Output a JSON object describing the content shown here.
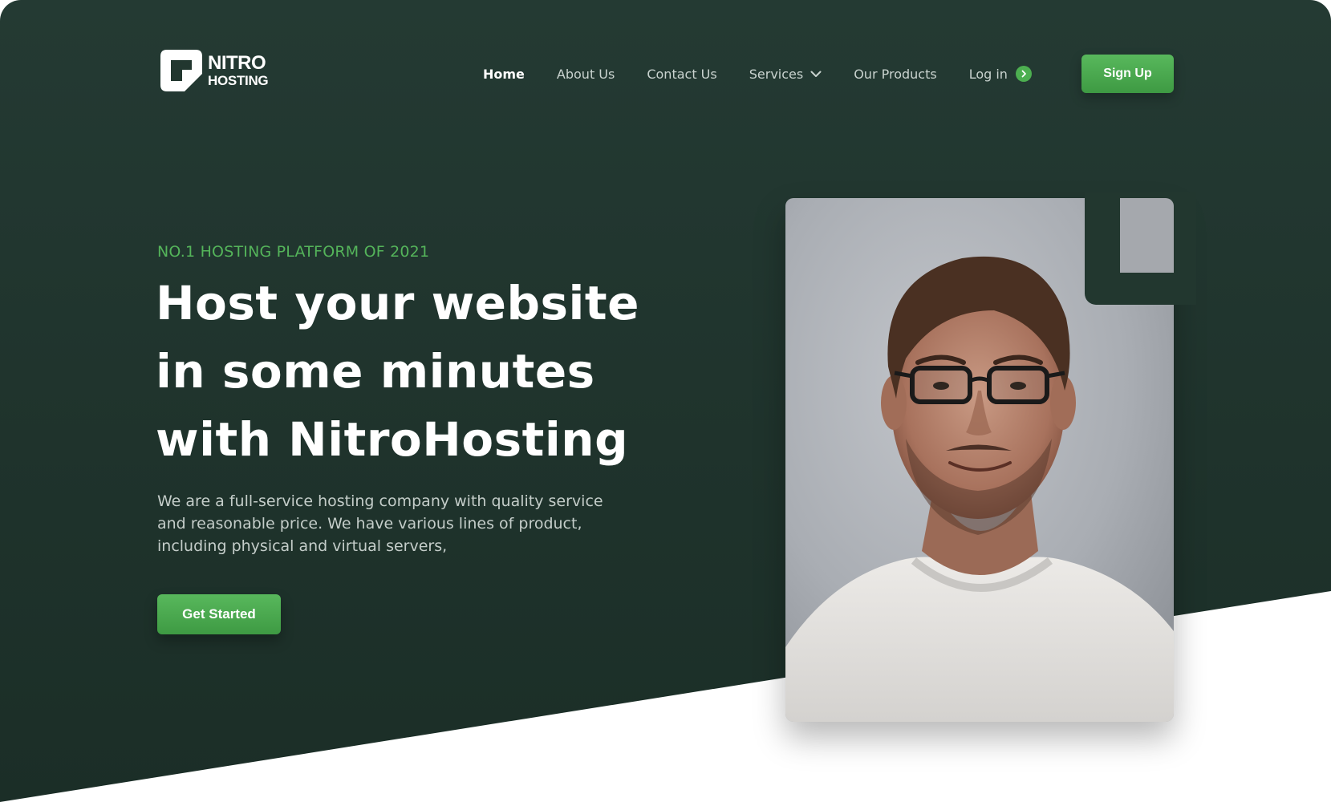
{
  "header": {
    "logo": {
      "line1": "NITRO",
      "line2": "HOSTING",
      "icon": "nitro-logo-icon"
    },
    "nav": [
      {
        "label": "Home",
        "active": true
      },
      {
        "label": "About Us"
      },
      {
        "label": "Contact Us"
      },
      {
        "label": "Services",
        "icon": "chevron-down-icon"
      },
      {
        "label": "Our Products"
      },
      {
        "label": "Log in",
        "icon": "arrow-right-circle-icon"
      }
    ],
    "signup_label": "Sign Up"
  },
  "hero": {
    "eyebrow": "NO.1 HOSTING PLATFORM OF 2021",
    "headline": {
      "line1": "Host your website",
      "line2": "in some minutes",
      "line3": "with NitroHosting"
    },
    "description": "We are a full-service hosting company with quality service and reasonable price. We have various lines of product, including physical and virtual servers,",
    "cta_label": "Get Started",
    "image": "portrait-photo"
  },
  "colors": {
    "background_dark": "#1f332c",
    "accent_green": "#4caf50",
    "eyebrow_green": "#54b45a",
    "white": "#ffffff"
  }
}
